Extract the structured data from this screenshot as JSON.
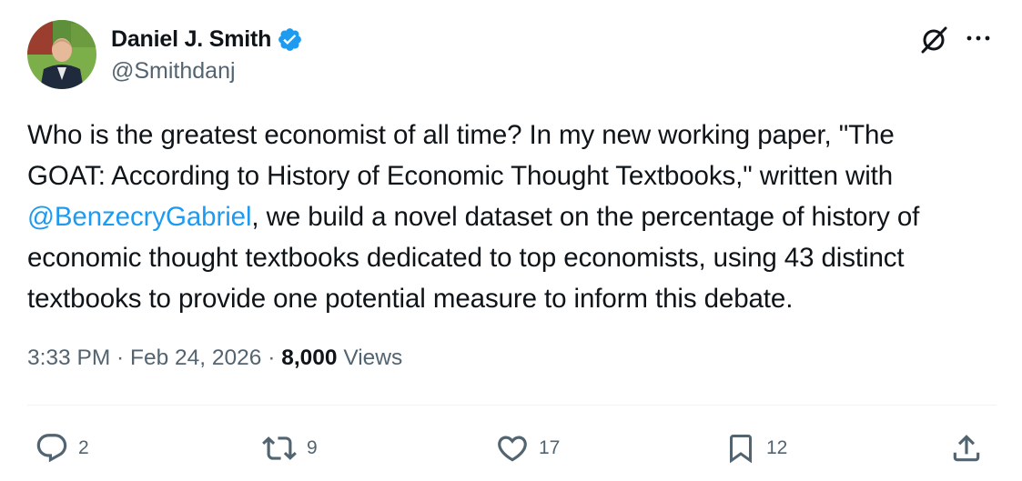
{
  "author": {
    "display_name": "Daniel J. Smith",
    "handle": "@Smithdanj",
    "verified": true
  },
  "tweet": {
    "lines": [
      {
        "segments": [
          {
            "text": "Who is the greatest economist of all time? In my new working paper, \"The",
            "mention": false
          }
        ]
      },
      {
        "segments": [
          {
            "text": "GOAT: According to History of Economic Thought Textbooks,\" written with",
            "mention": false
          }
        ]
      },
      {
        "segments": [
          {
            "text": "@BenzecryGabriel",
            "mention": true
          },
          {
            "text": ", we build a novel dataset on the percentage of history of",
            "mention": false
          }
        ]
      },
      {
        "segments": [
          {
            "text": "economic thought textbooks dedicated to top economists, using 43 distinct",
            "mention": false
          }
        ]
      },
      {
        "segments": [
          {
            "text": "textbooks to provide one potential measure to inform this debate.",
            "mention": false
          }
        ]
      }
    ]
  },
  "meta": {
    "time": "3:33 PM",
    "sep1": " · ",
    "date": "Feb 24, 2026",
    "sep2": " · ",
    "views_count": "8,000",
    "views_label": " Views"
  },
  "actions": {
    "replies": "2",
    "reposts": "9",
    "likes": "17",
    "bookmarks": "12"
  },
  "colors": {
    "accent": "#1d9bf0",
    "text": "#0f1419",
    "secondary": "#536471"
  },
  "icons": [
    "verified-badge-icon",
    "grok-icon",
    "more-icon",
    "reply-icon",
    "repost-icon",
    "like-icon",
    "bookmark-icon",
    "share-icon"
  ]
}
